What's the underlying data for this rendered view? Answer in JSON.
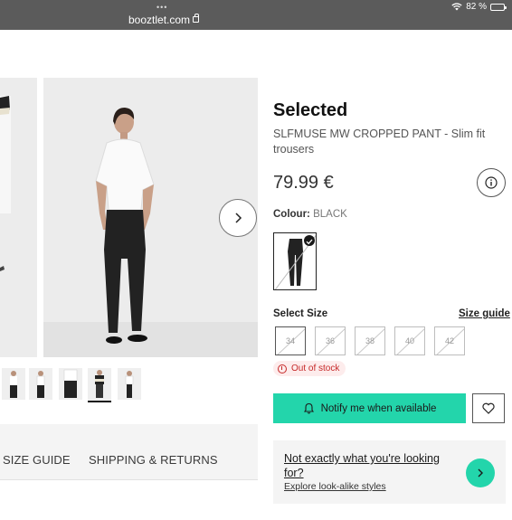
{
  "browser": {
    "dots": "•••",
    "url": "booztlet.com",
    "battery_percent": "82 %",
    "battery_level": 0.82
  },
  "gallery": {
    "next_icon": "chevron-right-icon",
    "thumb_count": 5
  },
  "tabs": {
    "size_guide": "SIZE GUIDE",
    "shipping": "SHIPPING & RETURNS"
  },
  "product": {
    "brand": "Selected",
    "name": "SLFMUSE MW CROPPED PANT - Slim fit trousers",
    "price": "79.99 €",
    "colour_label": "Colour:",
    "colour_value": "BLACK"
  },
  "size": {
    "label": "Select Size",
    "guide": "Size guide",
    "options": [
      "34",
      "36",
      "38",
      "40",
      "42"
    ],
    "selected": "34",
    "out_of_stock": "Out of stock"
  },
  "actions": {
    "notify": "Notify me when available"
  },
  "lookalike": {
    "title": "Not exactly what you're looking for?",
    "subtitle": "Explore look-alike styles"
  },
  "colors": {
    "accent": "#23d5ab",
    "oos_text": "#c62828",
    "oos_bg": "#fdecec",
    "chrome": "#5b5b5b"
  }
}
